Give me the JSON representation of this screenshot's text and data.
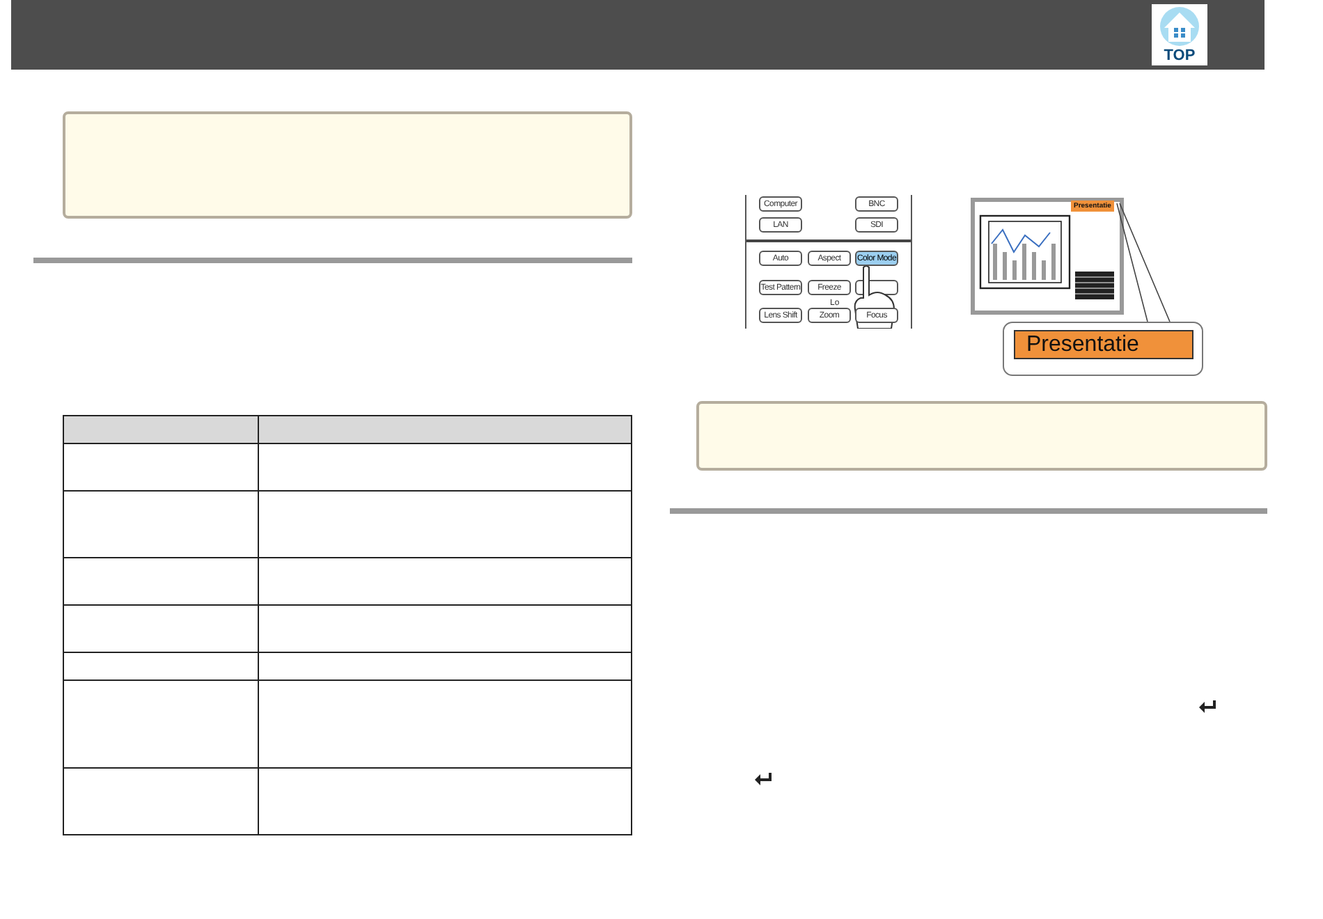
{
  "header": {
    "top_button": "TOP"
  },
  "table": {
    "rows": [
      {
        "kind": "header"
      },
      {
        "kind": "two_line"
      },
      {
        "kind": "three_line"
      },
      {
        "kind": "two_line"
      },
      {
        "kind": "two_line"
      },
      {
        "kind": "one_line"
      },
      {
        "kind": "four_line"
      },
      {
        "kind": "three_line"
      }
    ]
  },
  "remote": {
    "rows": [
      [
        {
          "kind": "key",
          "label": "Computer",
          "selected": false
        },
        {
          "kind": "gap"
        },
        {
          "kind": "key",
          "label": "BNC",
          "selected": false
        }
      ],
      [
        {
          "kind": "key",
          "label": "LAN",
          "selected": false
        },
        {
          "kind": "gap"
        },
        {
          "kind": "key",
          "label": "SDI",
          "selected": false
        }
      ],
      [
        {
          "kind": "key",
          "label": "Auto",
          "selected": false
        },
        {
          "kind": "key",
          "label": "Aspect",
          "selected": false
        },
        {
          "kind": "key",
          "label": "Color Mode",
          "selected": true
        }
      ],
      [
        {
          "kind": "key",
          "label": "Test Pattern",
          "selected": false
        },
        {
          "kind": "key",
          "label": "Freeze",
          "selected": false
        },
        {
          "kind": "covered"
        }
      ],
      [
        {
          "kind": "key",
          "label": "Lens Shift",
          "selected": false
        },
        {
          "kind": "key",
          "label": "Zoom",
          "selected": false
        },
        {
          "kind": "key",
          "label": "Focus",
          "selected": false
        }
      ]
    ],
    "group_label": "Lo"
  },
  "screen": {
    "mode_label": "Presentatie",
    "callout_label": "Presentatie"
  },
  "steps": [
    {
      "kind": "enter"
    },
    {
      "kind": "enter"
    }
  ]
}
